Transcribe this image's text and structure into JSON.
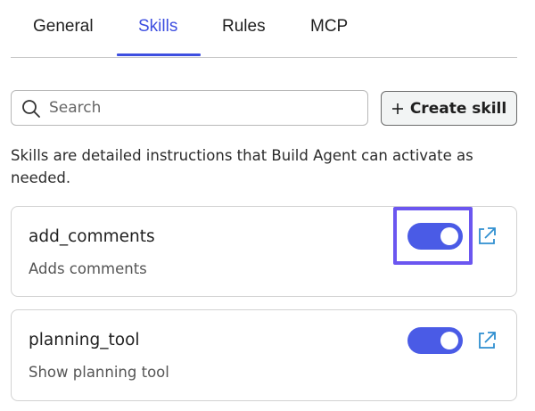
{
  "tabs": [
    {
      "label": "General",
      "active": false
    },
    {
      "label": "Skills",
      "active": true
    },
    {
      "label": "Rules",
      "active": false
    },
    {
      "label": "MCP",
      "active": false
    }
  ],
  "search": {
    "placeholder": "Search",
    "value": "",
    "icon": "search-icon"
  },
  "create_button": {
    "label": "Create skill",
    "icon": "plus-icon"
  },
  "description": "Skills are detailed instructions that Build Agent can activate as needed.",
  "skills": [
    {
      "name": "add_comments",
      "description": "Adds comments",
      "enabled": true,
      "highlighted": true
    },
    {
      "name": "planning_tool",
      "description": "Show planning tool",
      "enabled": true,
      "highlighted": false
    }
  ],
  "colors": {
    "accent": "#3d4ee0",
    "toggle_on": "#4a5be6",
    "highlight_border": "#6b56f0",
    "link_icon": "#2f8fd0"
  }
}
